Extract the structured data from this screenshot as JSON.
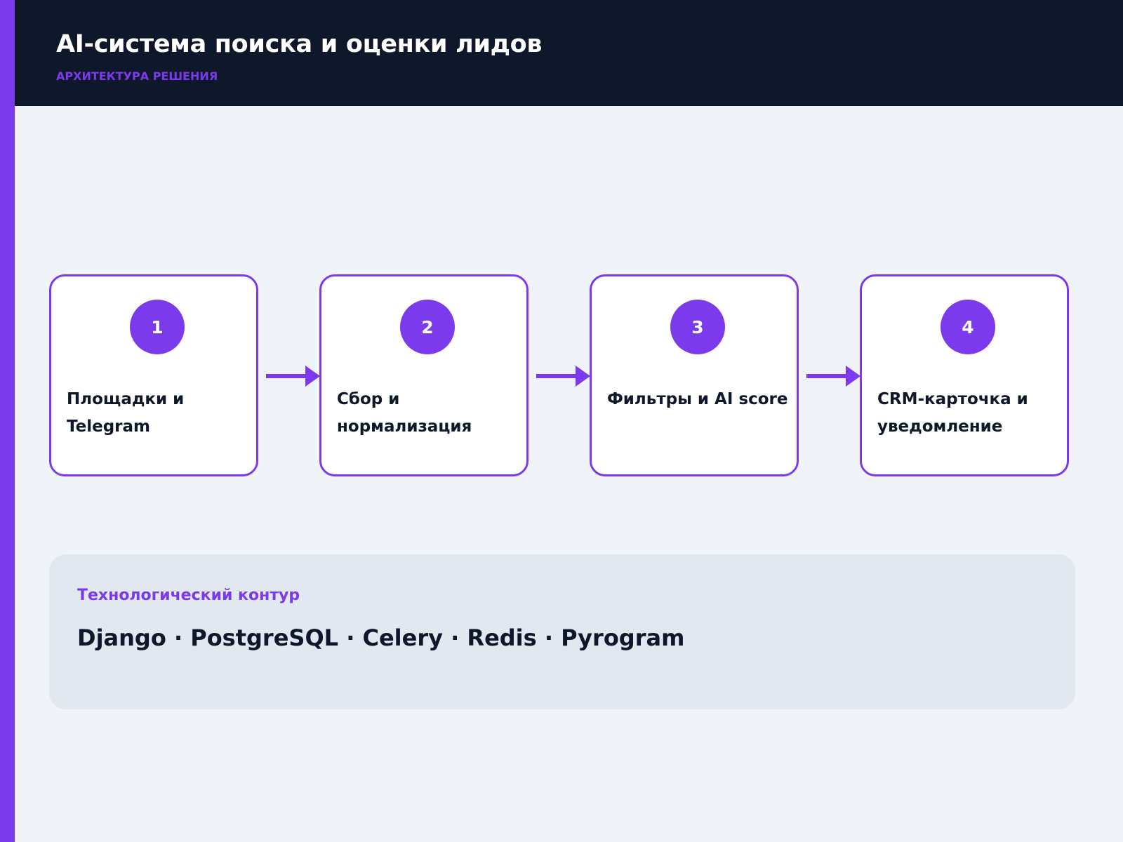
{
  "header": {
    "title": "AI-система поиска и оценки лидов",
    "subtitle": "АРХИТЕКТУРА РЕШЕНИЯ"
  },
  "steps": [
    {
      "number": "1",
      "label": "Площадки и Telegram"
    },
    {
      "number": "2",
      "label": "Сбор и нормализация"
    },
    {
      "number": "3",
      "label": "Фильтры и AI score"
    },
    {
      "number": "4",
      "label": "CRM-карточка и уведомление"
    }
  ],
  "tech": {
    "label": "Технологический контур",
    "stack": "Django · PostgreSQL · Celery · Redis · Pyrogram"
  },
  "colors": {
    "accent": "#7c3aed",
    "header_bg": "#0f172b",
    "page_bg": "#f0f4f8",
    "panel_bg": "#e1e8f0",
    "text_dark": "#0f172b"
  }
}
